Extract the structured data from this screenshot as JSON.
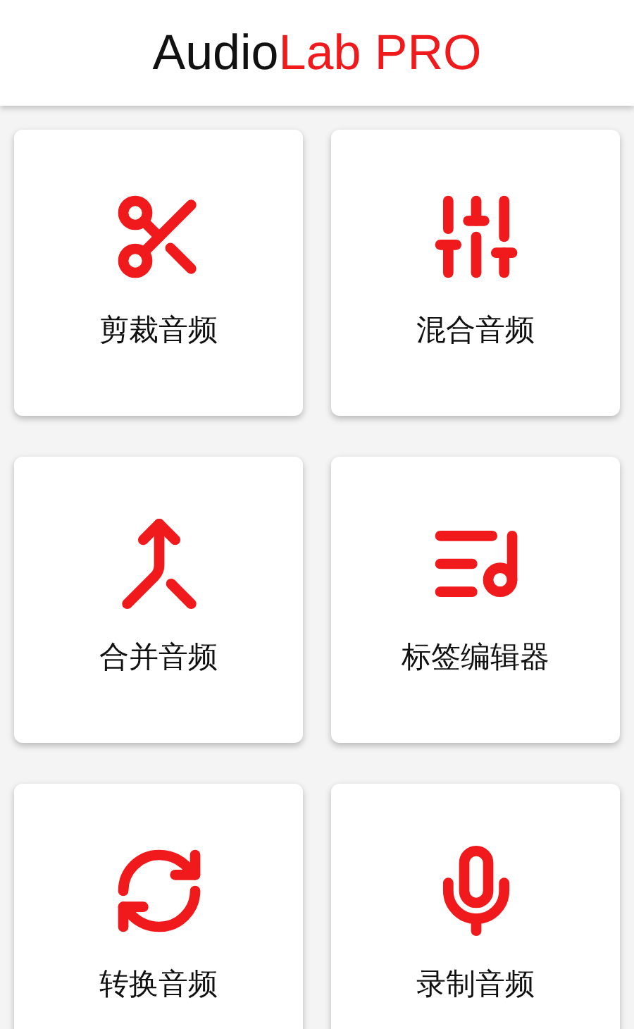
{
  "header": {
    "title_main": "Audio",
    "title_accent": "Lab PRO"
  },
  "tiles": [
    {
      "label": "剪裁音频"
    },
    {
      "label": "混合音频"
    },
    {
      "label": "合并音频"
    },
    {
      "label": "标签编辑器"
    },
    {
      "label": "转换音频"
    },
    {
      "label": "录制音频"
    }
  ]
}
